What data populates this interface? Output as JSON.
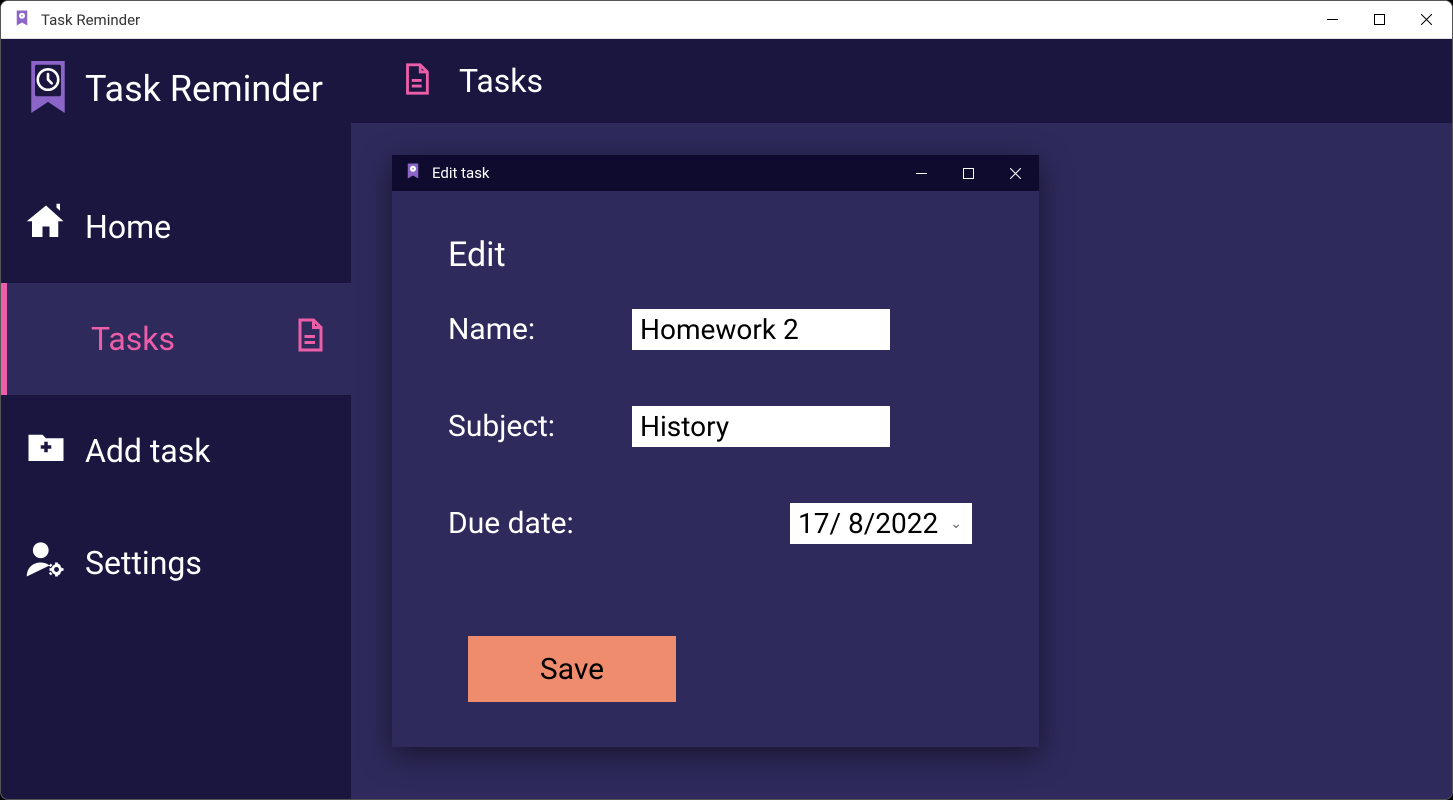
{
  "window": {
    "title": "Task Reminder"
  },
  "app": {
    "name": "Task Reminder"
  },
  "sidebar": {
    "items": [
      {
        "label": "Home"
      },
      {
        "label": "Tasks"
      },
      {
        "label": "Add task"
      },
      {
        "label": "Settings"
      }
    ]
  },
  "main": {
    "header_title": "Tasks"
  },
  "modal": {
    "title": "Edit task",
    "heading": "Edit",
    "fields": {
      "name": {
        "label": "Name:",
        "value": "Homework 2"
      },
      "subject": {
        "label": "Subject:",
        "value": "History"
      },
      "due_date": {
        "label": "Due date:",
        "value": "17/  8/2022"
      }
    },
    "save_label": "Save"
  }
}
